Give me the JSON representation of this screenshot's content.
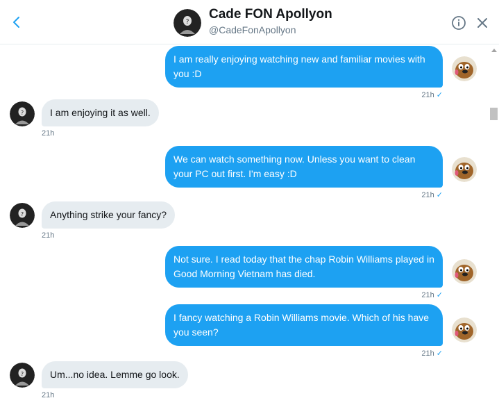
{
  "header": {
    "name": "Cade FON Apollyon",
    "handle": "@CadeFonApollyon"
  },
  "messages": [
    {
      "dir": "sent",
      "text": "I am really enjoying watching new and familiar movies with you :D",
      "time": "21h"
    },
    {
      "dir": "recv",
      "text": "I am enjoying it as well.",
      "time": "21h"
    },
    {
      "dir": "sent",
      "text": "We can watch something now. Unless you want to clean your PC out first. I'm easy :D",
      "time": "21h"
    },
    {
      "dir": "recv",
      "text": "Anything strike your fancy?",
      "time": "21h"
    },
    {
      "dir": "sent",
      "text": "Not sure. I read today that the chap Robin Williams played in Good Morning Vietnam has died.",
      "time": "21h"
    },
    {
      "dir": "sent",
      "text": "I fancy watching a Robin Williams movie. Which of his have you seen?",
      "time": "21h"
    },
    {
      "dir": "recv",
      "text": "Um...no idea. Lemme go look.",
      "time": "21h"
    }
  ],
  "colors": {
    "sent_bubble": "#1da1f2",
    "recv_bubble": "#e6ecf0",
    "muted_text": "#657786"
  },
  "icons": {
    "back": "chevron-left-icon",
    "info": "info-circle-icon",
    "close": "close-icon",
    "read": "checkmark-icon"
  }
}
